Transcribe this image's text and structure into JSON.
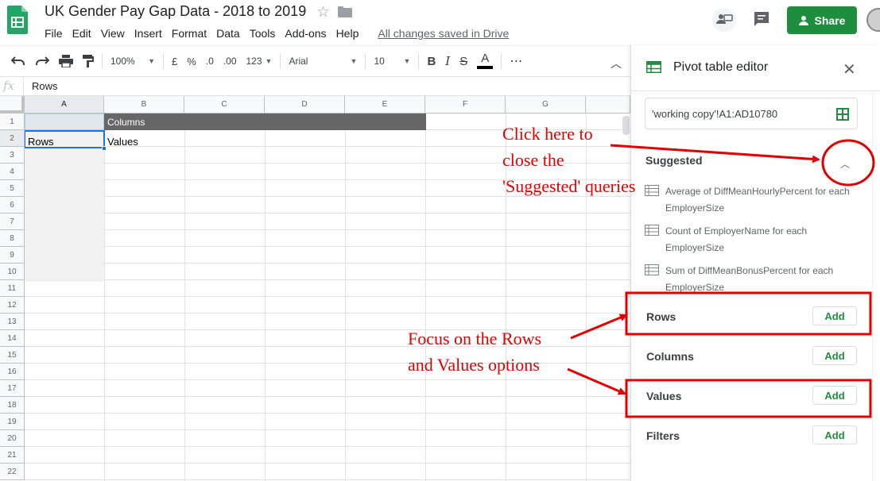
{
  "doc": {
    "title": "UK Gender Pay Gap Data - 2018 to 2019",
    "saved_status": "All changes saved in Drive",
    "share_label": "Share"
  },
  "menu": [
    "File",
    "Edit",
    "View",
    "Insert",
    "Format",
    "Data",
    "Tools",
    "Add-ons",
    "Help"
  ],
  "toolbar": {
    "zoom": "100%",
    "currency": "£",
    "percent": "%",
    "decimal_less": ".0",
    "decimal_more": ".00",
    "more_formats": "123",
    "font": "Arial",
    "font_size": "10",
    "bold": "B",
    "italic": "I",
    "strike": "S",
    "text_color": "A",
    "more": "⋯"
  },
  "formula_bar": {
    "fx": "fx",
    "value": "Rows"
  },
  "grid": {
    "columns": [
      "A",
      "B",
      "C",
      "D",
      "E",
      "F",
      "G"
    ],
    "rows": [
      "1",
      "2",
      "3",
      "4",
      "5",
      "6",
      "7",
      "8",
      "9",
      "10",
      "11",
      "12",
      "13",
      "14",
      "15",
      "16",
      "17",
      "18",
      "19",
      "20",
      "21",
      "22"
    ],
    "cells": {
      "B1": "Columns",
      "A2": "Rows",
      "B2": "Values"
    }
  },
  "pivot_editor": {
    "title": "Pivot table editor",
    "range": "'working copy'!A1:AD10780",
    "suggested_label": "Suggested",
    "suggestions": [
      "Average of DiffMeanHourlyPercent for each EmployerSize",
      "Count of EmployerName for each EmployerSize",
      "Sum of DiffMeanBonusPercent for each EmployerSize"
    ],
    "sections": [
      {
        "label": "Rows",
        "button": "Add"
      },
      {
        "label": "Columns",
        "button": "Add"
      },
      {
        "label": "Values",
        "button": "Add"
      },
      {
        "label": "Filters",
        "button": "Add"
      }
    ]
  },
  "annotations": {
    "close_suggested": [
      "Click here to",
      "close the",
      "'Suggested' queries"
    ],
    "focus_rows_values": [
      "Focus on the Rows",
      "and Values options"
    ],
    "color": "#e00000"
  },
  "colors": {
    "share_green": "#1e8e3e",
    "selection_blue": "#1a73e8",
    "columns_band": "#666666"
  }
}
